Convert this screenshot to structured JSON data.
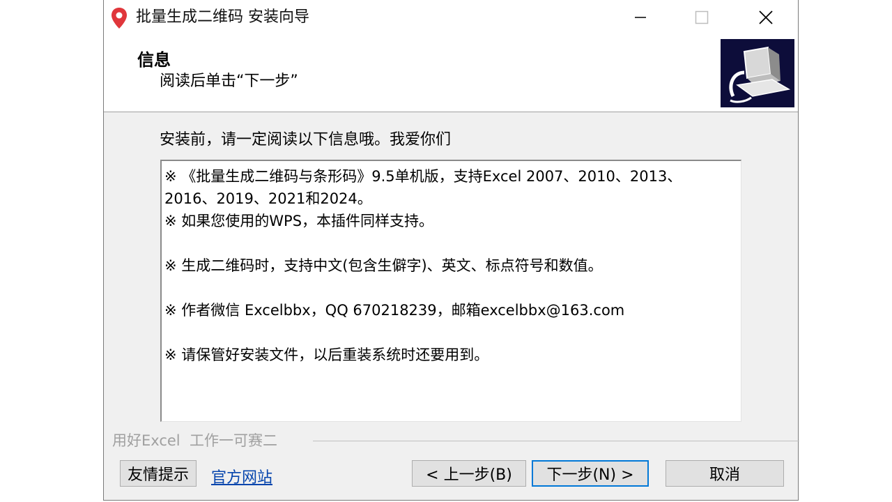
{
  "window": {
    "title": "批量生成二维码 安装向导"
  },
  "header": {
    "title": "信息",
    "subtitle": "阅读后单击“下一步”"
  },
  "body": {
    "intro": "安装前，请一定阅读以下信息哦。我爱你们",
    "info_lines": [
      "※ 《批量生成二维码与条形码》9.5单机版，支持Excel 2007、2010、2013、",
      "2016、2019、2021和2024。",
      "※ 如果您使用的WPS，本插件同样支持。",
      "",
      "※ 生成二维码时，支持中文(包含生僻字)、英文、标点符号和数值。",
      "",
      "※ 作者微信 Excelbbx，QQ 670218239，邮箱excelbbx@163.com",
      "",
      "※ 请保管好安装文件，以后重装系统时还要用到。"
    ]
  },
  "footer": {
    "brand_text": "用好Excel  工作一可赛二",
    "tip_button": "友情提示",
    "website_link": "官方网站",
    "back_button": "< 上一步(B)",
    "next_button": "下一步(N) >",
    "cancel_button": "取消"
  },
  "colors": {
    "link": "#0645ad",
    "focus_border": "#0078d7",
    "header_image_bg": "#0d0d3a"
  },
  "icons": [
    "map-pin-icon",
    "minimize-icon",
    "maximize-icon",
    "close-icon",
    "computer-setup-icon"
  ]
}
